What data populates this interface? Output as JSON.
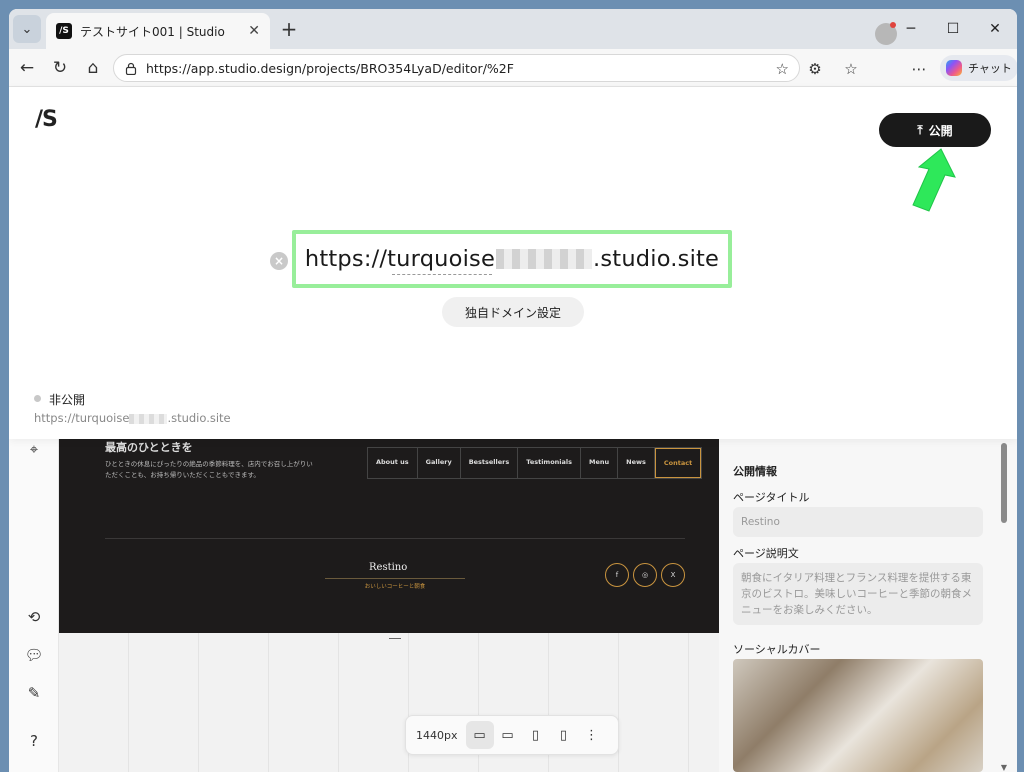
{
  "browser": {
    "tab_title": "テストサイト001 | Studio",
    "tab_favicon": "/S",
    "url": "https://app.studio.design/projects/BRO354LyaD/editor/%2F",
    "chat_label": "チャット"
  },
  "publish": {
    "logo": "/S",
    "button_label": "公開",
    "site_url_prefix": "https://turquoise",
    "site_url_suffix": ".studio.site",
    "domain_button": "独自ドメイン設定",
    "status_label": "非公開",
    "status_url_prefix": "https://turquoise",
    "status_url_suffix": ".studio.site"
  },
  "site_footer": {
    "heading": "最高のひとときを",
    "text": "ひとときの休息にぴったりの絶品の季節料理を、店内でお召し上がりいただくことも、お持ち帰りいただくこともできます。",
    "nav": [
      "About us",
      "Gallery",
      "Bestsellers",
      "Testimonials",
      "Menu",
      "News",
      "Contact"
    ],
    "brand": "Restino",
    "brand_sub": "おいしいコーヒーと朝食",
    "social": [
      "f",
      "◎",
      "X"
    ]
  },
  "device_bar": {
    "width_label": "1440px"
  },
  "right_panel": {
    "section_title": "公開情報",
    "page_title_label": "ページタイトル",
    "page_title_placeholder": "Restino",
    "page_desc_label": "ページ説明文",
    "page_desc_placeholder": "朝食にイタリア料理とフランス料理を提供する東京のビストロ。美味しいコーヒーと季節の朝食メニューをお楽しみください。",
    "social_cover_label": "ソーシャルカバー"
  },
  "colors": {
    "publish_button": "#1a1a1a",
    "url_highlight": "#98ee9a",
    "annotation_arrow": "#2ee85a",
    "footer_bg": "#1d1b1b",
    "footer_accent": "#c9943f"
  }
}
